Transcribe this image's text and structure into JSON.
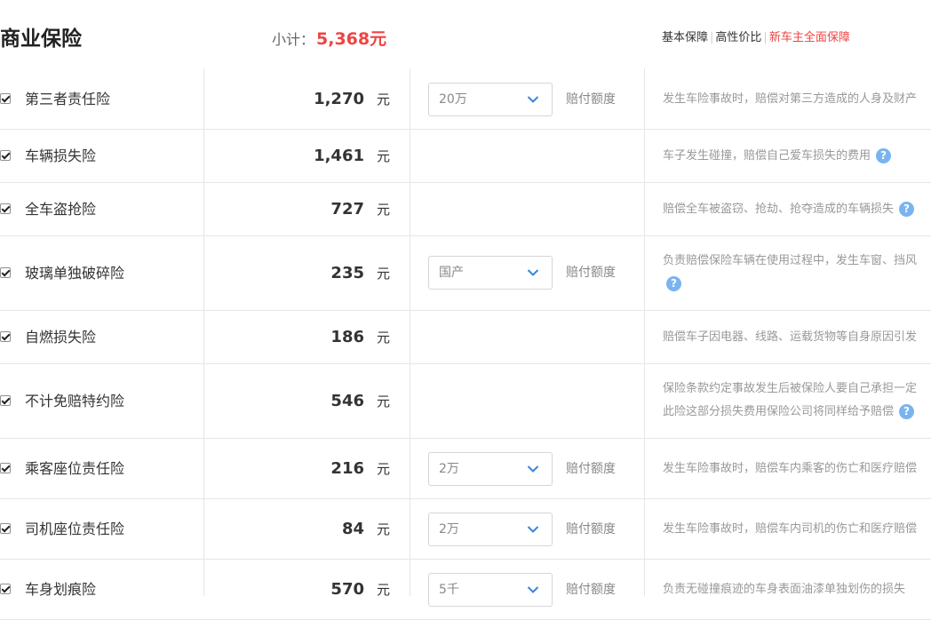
{
  "header": {
    "title": "商业保险",
    "subtotal_label": "小计：",
    "subtotal_value": "5,368元",
    "plans": [
      "基本保障",
      "高性价比",
      "新车主全面保障"
    ]
  },
  "rows": [
    {
      "name": "第三者责任险",
      "price": "1,270",
      "unit": "元",
      "coverage": "20万",
      "coverage_label": "赔付额度",
      "desc": [
        "发生车险事故时，赔偿对第三方造成的人身及财产"
      ]
    },
    {
      "name": "车辆损失险",
      "price": "1,461",
      "unit": "元",
      "desc": [
        "车子发生碰撞，赔偿自己爱车损失的费用"
      ]
    },
    {
      "name": "全车盗抢险",
      "price": "727",
      "unit": "元",
      "desc": [
        "赔偿全车被盗窃、抢劫、抢夺造成的车辆损失"
      ]
    },
    {
      "name": "玻璃单独破碎险",
      "price": "235",
      "unit": "元",
      "coverage": "国产",
      "coverage_label": "赔付额度",
      "desc": [
        "负责赔偿保险车辆在使用过程中，发生车窗、挡风"
      ]
    },
    {
      "name": "自燃损失险",
      "price": "186",
      "unit": "元",
      "desc": [
        "赔偿车子因电器、线路、运载货物等自身原因引发"
      ]
    },
    {
      "name": "不计免赔特约险",
      "price": "546",
      "unit": "元",
      "desc": [
        "保险条款约定事故发生后被保险人要自己承担一定",
        "此险这部分损失费用保险公司将同样给予赔偿"
      ]
    },
    {
      "name": "乘客座位责任险",
      "price": "216",
      "unit": "元",
      "coverage": "2万",
      "coverage_label": "赔付额度",
      "desc": [
        "发生车险事故时，赔偿车内乘客的伤亡和医疗赔偿"
      ]
    },
    {
      "name": "司机座位责任险",
      "price": "84",
      "unit": "元",
      "coverage": "2万",
      "coverage_label": "赔付额度",
      "desc": [
        "发生车险事故时，赔偿车内司机的伤亡和医疗赔偿"
      ]
    },
    {
      "name": "车身划痕险",
      "price": "570",
      "unit": "元",
      "coverage": "5千",
      "coverage_label": "赔付额度",
      "desc": [
        "负责无碰撞痕迹的车身表面油漆单独划伤的损失"
      ]
    }
  ],
  "icons": {
    "help": "question-mark-circle-icon",
    "dropdown": "chevron-down-icon",
    "checkbox": "checked-checkbox"
  },
  "colors": {
    "accent": "#ee4444",
    "help": "#7ab4f0",
    "border": "#e6e6e6"
  }
}
